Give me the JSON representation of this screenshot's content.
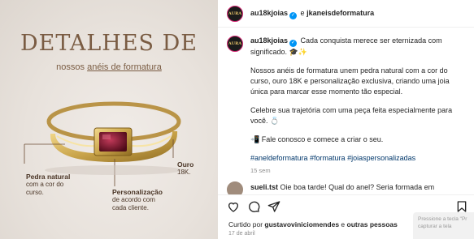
{
  "image": {
    "title": "DETALHES DE",
    "subtitle_prefix": "nossos ",
    "subtitle_link": "anéis de formatura",
    "callouts": [
      {
        "title": "Pedra natural",
        "text": [
          "com a cor do",
          "curso."
        ]
      },
      {
        "title": "Personalização",
        "text": [
          "de acordo com",
          "cada cliente."
        ]
      },
      {
        "title": "Ouro",
        "text": [
          "18K."
        ]
      }
    ]
  },
  "header": {
    "avatar_text": "AURA",
    "username": "au18kjoias",
    "separator": "e",
    "collaborator": "jkaneisdeformatura"
  },
  "caption": {
    "username": "au18kjoias",
    "intro": "Cada conquista merece ser eternizada com significado. 🎓✨",
    "para1": "Nossos anéis de formatura unem pedra natural com a cor do curso, ouro 18K e personalização exclusiva, criando uma joia única para marcar esse momento tão especial.",
    "para2": "Celebre sua trajetória com uma peça feita especialmente para você. 💍",
    "para3": "📲 Fale conosco e comece a criar o seu.",
    "hashtags": "#aneldeformatura #formatura #joiaspersonalizadas",
    "time": "15 sem"
  },
  "comment": {
    "username": "sueli.tst",
    "text": "Oie boa tarde! Qual do anel? Seria formada em"
  },
  "actions": {
    "liked_prefix": "Curtido por ",
    "liked_user": "gustavoviniciomendes",
    "liked_suffix": " e ",
    "liked_others": "outras pessoas",
    "date": "17 de abril"
  },
  "toast": {
    "line1": "Pressione a tecla \"Pr",
    "line2": "capturar a tela"
  },
  "colors": {
    "accent_blue": "#0095f6",
    "hashtag_blue": "#00376b",
    "gold": "#c9a44a",
    "stone": "#8a1a2e"
  }
}
